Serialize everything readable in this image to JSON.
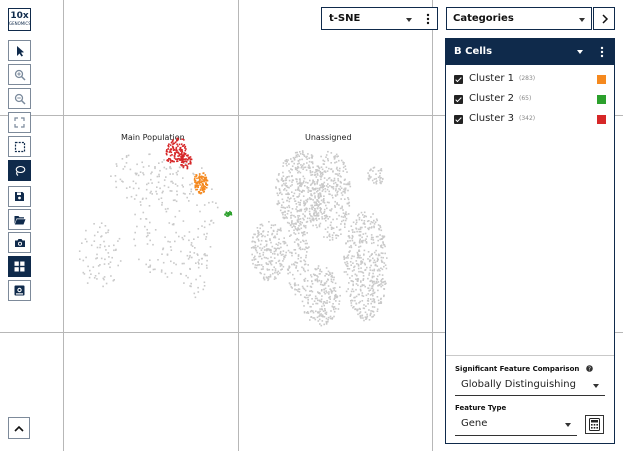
{
  "logo": {
    "main": "10x",
    "sub": "GENOMICS"
  },
  "toolbar": {
    "tools": [
      {
        "id": "select",
        "icon": "arrow-pointer-icon"
      },
      {
        "id": "zoom-in",
        "icon": "zoom-in-icon"
      },
      {
        "id": "zoom-out",
        "icon": "zoom-out-icon"
      },
      {
        "id": "fit",
        "icon": "fit-to-screen-icon"
      },
      {
        "id": "box-select",
        "icon": "box-select-icon"
      },
      {
        "id": "lasso",
        "icon": "lasso-icon"
      },
      {
        "id": "save",
        "icon": "save-icon"
      },
      {
        "id": "open",
        "icon": "folder-open-icon"
      },
      {
        "id": "screenshot",
        "icon": "camera-icon"
      },
      {
        "id": "layout",
        "icon": "grid-layout-icon"
      },
      {
        "id": "export",
        "icon": "export-image-icon"
      }
    ],
    "active": [
      "lasso",
      "layout"
    ]
  },
  "projection": {
    "label": "t-SNE"
  },
  "category_select": {
    "label": "Categories"
  },
  "panel": {
    "title": "B Cells",
    "clusters": [
      {
        "name": "Cluster 1",
        "count": "(283)",
        "color": "#f5891e",
        "checked": true
      },
      {
        "name": "Cluster 2",
        "count": "(65)",
        "color": "#2ca02c",
        "checked": true
      },
      {
        "name": "Cluster 3",
        "count": "(342)",
        "color": "#d62728",
        "checked": true
      }
    ],
    "feature_comparison_label": "Significant Feature Comparison",
    "feature_comparison_value": "Globally Distinguishing",
    "feature_type_label": "Feature Type",
    "feature_type_value": "Gene"
  },
  "plot": {
    "main_population_label": "Main Population",
    "unassigned_label": "Unassigned",
    "colors": {
      "points": "#c9c9c9",
      "cluster1": "#f5891e",
      "cluster2": "#2ca02c",
      "cluster3": "#d62728"
    }
  }
}
